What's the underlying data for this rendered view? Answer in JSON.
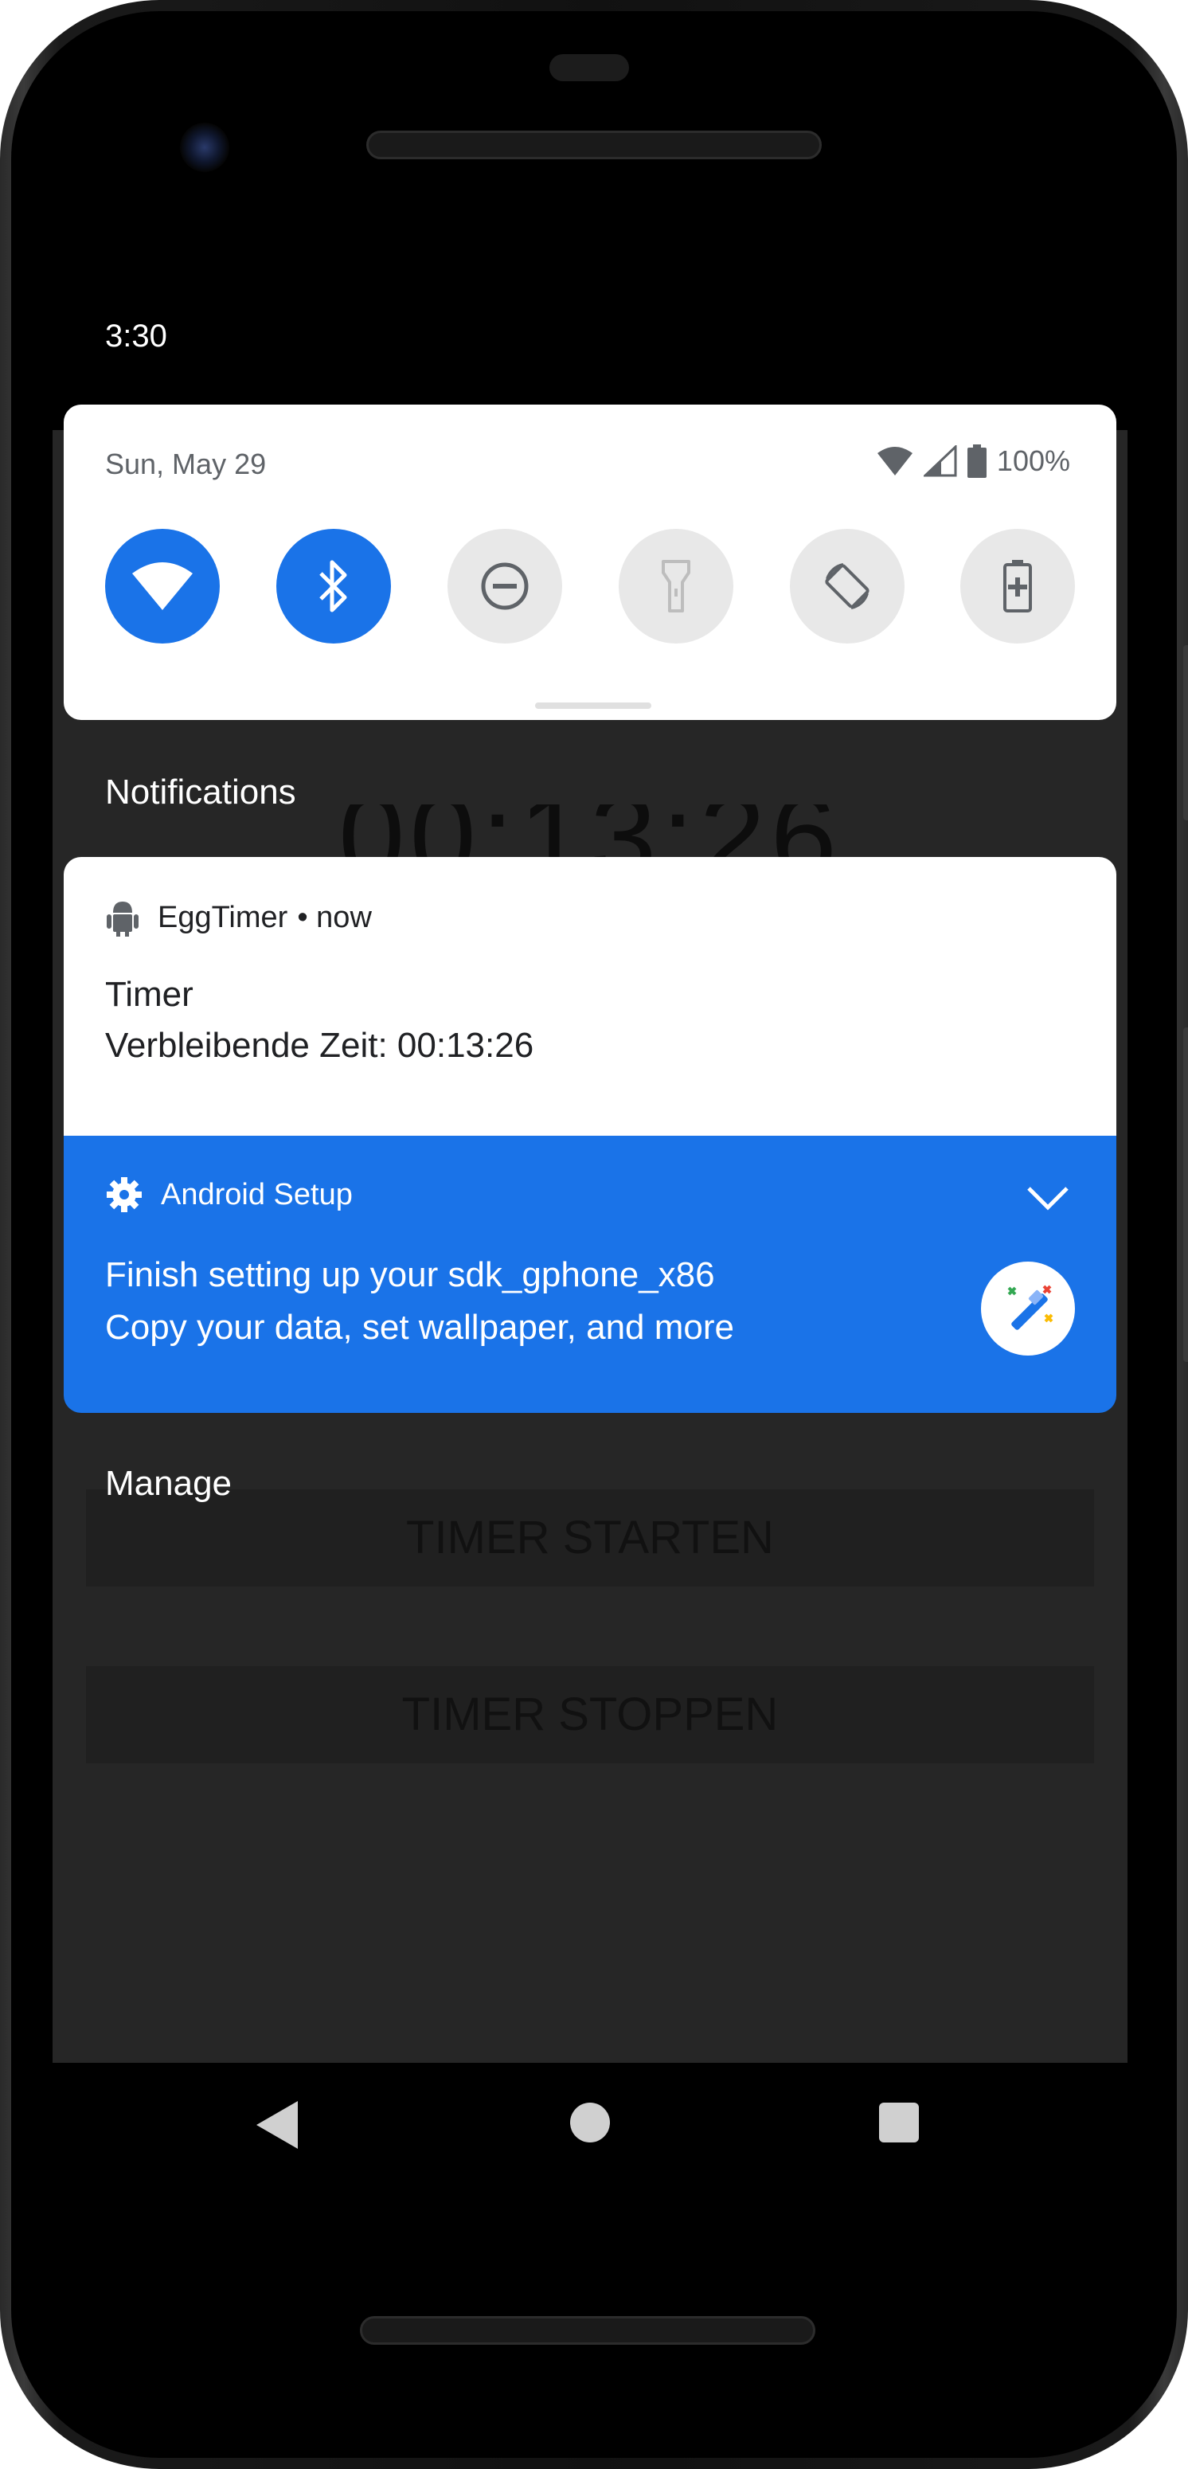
{
  "status_bar": {
    "time": "3:30"
  },
  "quick_settings": {
    "date": "Sun, May 29",
    "battery": "100%",
    "tiles": [
      {
        "name": "wifi",
        "state": "on"
      },
      {
        "name": "bluetooth",
        "state": "on"
      },
      {
        "name": "do-not-disturb",
        "state": "off"
      },
      {
        "name": "flashlight",
        "state": "off"
      },
      {
        "name": "auto-rotate",
        "state": "off"
      },
      {
        "name": "battery-saver",
        "state": "off"
      }
    ]
  },
  "notifications": {
    "header": "Notifications",
    "items": [
      {
        "app": "EggTimer",
        "time": "• now",
        "title": "Timer",
        "text": "Verbleibende Zeit: 00:13:26"
      },
      {
        "app": "Android Setup",
        "title": "Finish setting up your sdk_gphone_x86",
        "text": "Copy your data, set wallpaper, and more"
      }
    ],
    "manage": "Manage"
  },
  "background_app": {
    "time": "00:13:26",
    "start_button": "TIMER STARTEN",
    "stop_button": "TIMER STOPPEN"
  },
  "colors": {
    "accent": "#1a73e8",
    "panel": "#ffffff",
    "scrim": "#262626"
  }
}
